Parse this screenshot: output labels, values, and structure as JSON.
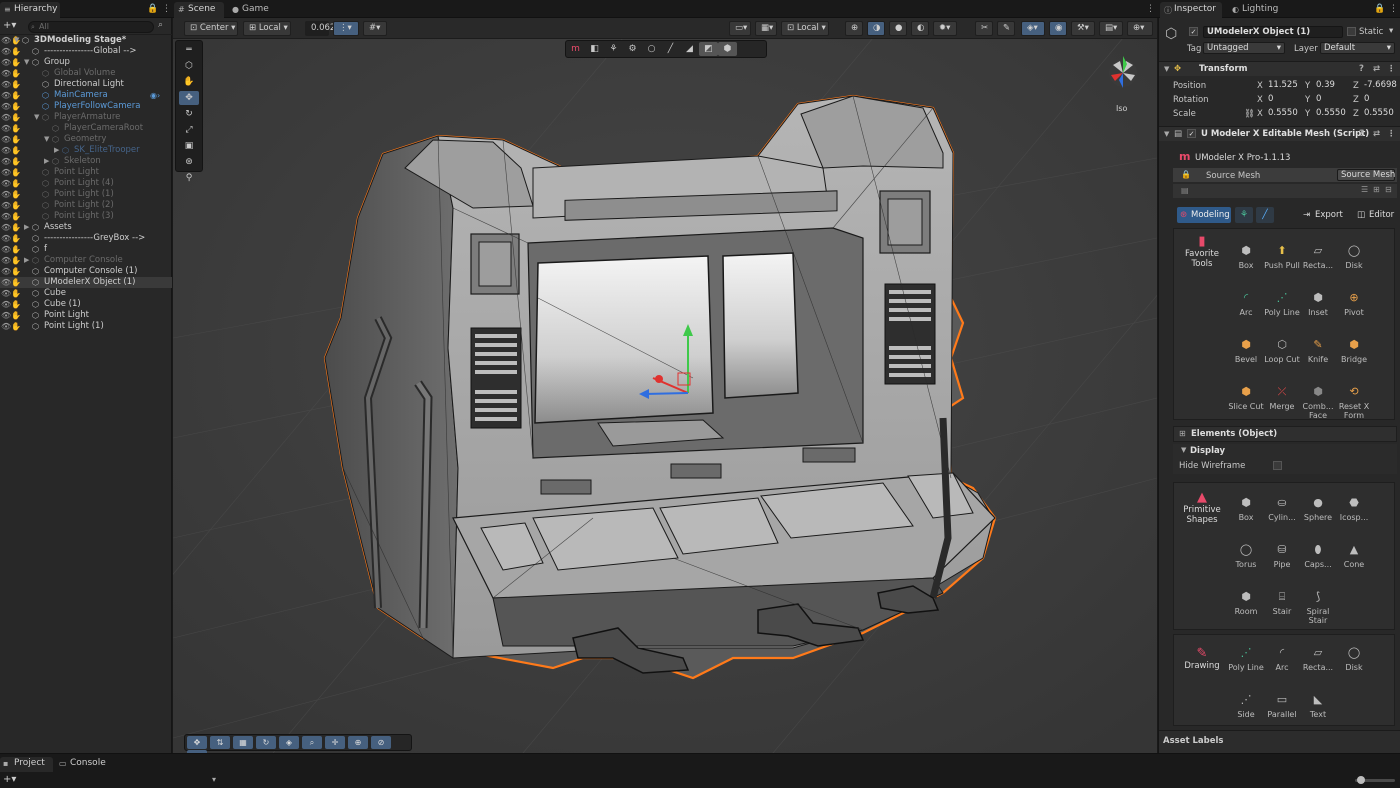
{
  "tabs": {
    "hierarchy": "Hierarchy",
    "scene": "Scene",
    "game": "Game",
    "inspector": "Inspector",
    "lighting": "Lighting",
    "project": "Project",
    "console": "Console"
  },
  "hierarchy": {
    "search_placeholder": "All",
    "items": [
      {
        "label": "3DModeling Stage*"
      },
      {
        "label": "----------------Global -->"
      },
      {
        "label": "Group"
      },
      {
        "label": "Global Volume"
      },
      {
        "label": "Directional Light"
      },
      {
        "label": "MainCamera"
      },
      {
        "label": "PlayerFollowCamera"
      },
      {
        "label": "PlayerArmature"
      },
      {
        "label": "PlayerCameraRoot"
      },
      {
        "label": "Geometry"
      },
      {
        "label": "SK_EliteTrooper"
      },
      {
        "label": "Skeleton"
      },
      {
        "label": "Point Light"
      },
      {
        "label": "Point Light (4)"
      },
      {
        "label": "Point Light (1)"
      },
      {
        "label": "Point Light (2)"
      },
      {
        "label": "Point Light (3)"
      },
      {
        "label": "Assets"
      },
      {
        "label": "----------------GreyBox -->"
      },
      {
        "label": "f"
      },
      {
        "label": "Computer Console"
      },
      {
        "label": "Computer Console (1)"
      },
      {
        "label": "UModelerX Object (1)"
      },
      {
        "label": "Cube"
      },
      {
        "label": "Cube (1)"
      },
      {
        "label": "Point Light"
      },
      {
        "label": "Point Light (1)"
      }
    ]
  },
  "scene_toolbar": {
    "pivot_mode": "Center",
    "pivot_space": "Local",
    "snap_value": "0.062",
    "right_space": "Local",
    "projection": "Iso"
  },
  "inspector": {
    "object_name": "UModelerX Object (1)",
    "static_label": "Static",
    "tag_label": "Tag",
    "tag_value": "Untagged",
    "layer_label": "Layer",
    "layer_value": "Default",
    "transform": {
      "title": "Transform",
      "position_label": "Position",
      "rotation_label": "Rotation",
      "scale_label": "Scale",
      "position": {
        "x": "11.525",
        "y": "0.39",
        "z": "-7.6698"
      },
      "rotation": {
        "x": "0",
        "y": "0",
        "z": "0"
      },
      "scale": {
        "x": "0.5550",
        "y": "0.5550",
        "z": "0.5550"
      }
    },
    "script": {
      "title": "U Modeler X Editable Mesh (Script)",
      "version": "UModeler X Pro-1.1.13",
      "source_mesh_label": "Source Mesh",
      "source_mesh_button": "Source Mesh",
      "modeling_tab": "Modeling",
      "export_button": "Export",
      "editor_button": "Editor"
    },
    "favorite_tools": {
      "title": "Favorite Tools",
      "tools": [
        "Box",
        "Push Pull",
        "Recta...",
        "Disk",
        "Arc",
        "Poly Line",
        "Inset",
        "Pivot",
        "Bevel",
        "Loop Cut",
        "Knife",
        "Bridge",
        "Slice Cut",
        "Merge",
        "Comb... Face",
        "Reset X Form"
      ]
    },
    "elements_title": "Elements (Object)",
    "display_title": "Display",
    "hide_wireframe": "Hide Wireframe",
    "primitive_shapes": {
      "title": "Primitive Shapes",
      "tools": [
        "Box",
        "Cylin...",
        "Sphere",
        "Icosp...",
        "Torus",
        "Pipe",
        "Caps...",
        "Cone",
        "Room",
        "Stair",
        "Spiral Stair"
      ]
    },
    "drawing": {
      "title": "Drawing",
      "tools": [
        "Poly Line",
        "Arc",
        "Recta...",
        "Disk",
        "Side",
        "Parallel",
        "Text"
      ]
    },
    "asset_labels": "Asset Labels"
  },
  "colors": {
    "selection_outline": "#ff7a1a",
    "accent_blue": "#46607f",
    "gizmo_x": "#e0322f",
    "gizmo_y": "#3fc94a",
    "gizmo_z": "#2f6ee0"
  }
}
